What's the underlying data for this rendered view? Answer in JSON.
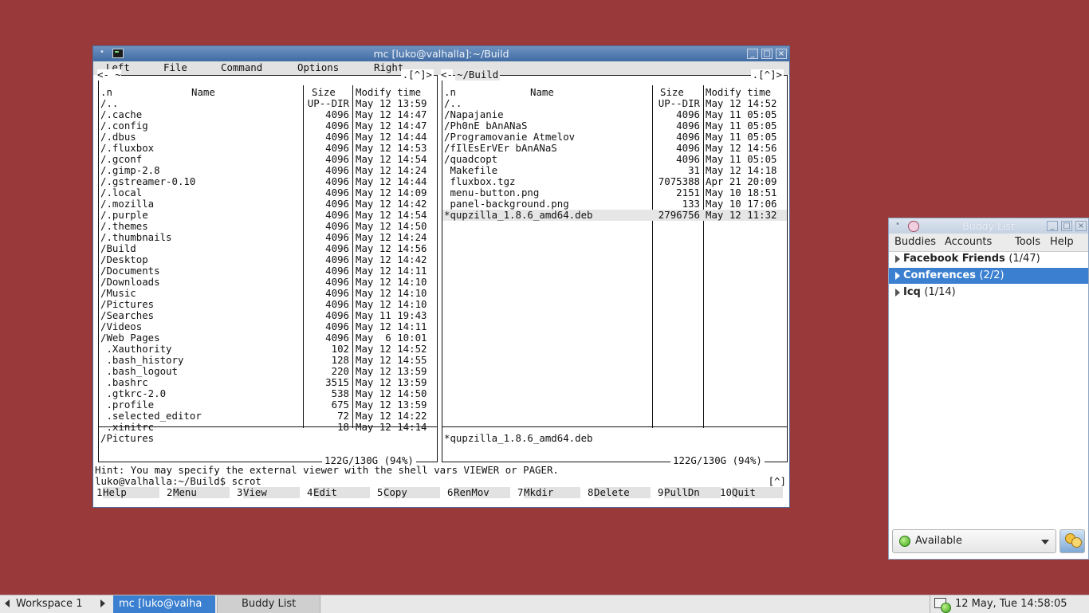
{
  "mc_window": {
    "title": "mc [luko@valhalla]:~/Build",
    "menu": [
      "Left",
      "File",
      "Command",
      "Options",
      "Right"
    ],
    "left_panel": {
      "path": "<- ~",
      "back": "<",
      "controls": ".[^]>",
      "headers": {
        "name_n": ".n",
        "name": "Name",
        "size": "Size",
        "time": "Modify time"
      },
      "rows": [
        {
          "name": "/..",
          "size": "UP--DIR",
          "time": "May 12 13:59"
        },
        {
          "name": "/.cache",
          "size": "4096",
          "time": "May 12 14:47"
        },
        {
          "name": "/.config",
          "size": "4096",
          "time": "May 12 14:47"
        },
        {
          "name": "/.dbus",
          "size": "4096",
          "time": "May 12 14:44"
        },
        {
          "name": "/.fluxbox",
          "size": "4096",
          "time": "May 12 14:53"
        },
        {
          "name": "/.gconf",
          "size": "4096",
          "time": "May 12 14:54"
        },
        {
          "name": "/.gimp-2.8",
          "size": "4096",
          "time": "May 12 14:24"
        },
        {
          "name": "/.gstreamer-0.10",
          "size": "4096",
          "time": "May 12 14:44"
        },
        {
          "name": "/.local",
          "size": "4096",
          "time": "May 12 14:09"
        },
        {
          "name": "/.mozilla",
          "size": "4096",
          "time": "May 12 14:42"
        },
        {
          "name": "/.purple",
          "size": "4096",
          "time": "May 12 14:54"
        },
        {
          "name": "/.themes",
          "size": "4096",
          "time": "May 12 14:50"
        },
        {
          "name": "/.thumbnails",
          "size": "4096",
          "time": "May 12 14:24"
        },
        {
          "name": "/Build",
          "size": "4096",
          "time": "May 12 14:56"
        },
        {
          "name": "/Desktop",
          "size": "4096",
          "time": "May 12 14:42"
        },
        {
          "name": "/Documents",
          "size": "4096",
          "time": "May 12 14:11"
        },
        {
          "name": "/Downloads",
          "size": "4096",
          "time": "May 12 14:10"
        },
        {
          "name": "/Music",
          "size": "4096",
          "time": "May 12 14:10"
        },
        {
          "name": "/Pictures",
          "size": "4096",
          "time": "May 12 14:10"
        },
        {
          "name": "/Searches",
          "size": "4096",
          "time": "May 11 19:43"
        },
        {
          "name": "/Videos",
          "size": "4096",
          "time": "May 12 14:11"
        },
        {
          "name": "/Web Pages",
          "size": "4096",
          "time": "May  6 10:01"
        },
        {
          "name": " .Xauthority",
          "size": "102",
          "time": "May 12 14:52"
        },
        {
          "name": " .bash_history",
          "size": "128",
          "time": "May 12 14:55"
        },
        {
          "name": " .bash_logout",
          "size": "220",
          "time": "May 12 13:59"
        },
        {
          "name": " .bashrc",
          "size": "3515",
          "time": "May 12 13:59"
        },
        {
          "name": " .gtkrc-2.0",
          "size": "538",
          "time": "May 12 14:50"
        },
        {
          "name": " .profile",
          "size": "675",
          "time": "May 12 13:59"
        },
        {
          "name": " .selected_editor",
          "size": "72",
          "time": "May 12 14:22"
        },
        {
          "name": " .xinitrc",
          "size": "18",
          "time": "May 12 14:14"
        }
      ],
      "mini_status": "/Pictures",
      "free_space": "122G/130G (94%)"
    },
    "right_panel": {
      "path": "~/Build",
      "back": "<-",
      "controls": ".[^]>",
      "headers": {
        "name_n": ".n",
        "name": "Name",
        "size": "Size",
        "time": "Modify time"
      },
      "rows": [
        {
          "name": "/..",
          "size": "UP--DIR",
          "time": "May 12 14:52"
        },
        {
          "name": "/Napajanie",
          "size": "4096",
          "time": "May 11 05:05"
        },
        {
          "name": "/Ph0nE bAnANaS",
          "size": "4096",
          "time": "May 11 05:05"
        },
        {
          "name": "/Programovanie Atmelov",
          "size": "4096",
          "time": "May 11 05:05"
        },
        {
          "name": "/fIlEsErVEr bAnANaS",
          "size": "4096",
          "time": "May 12 14:56"
        },
        {
          "name": "/quadcopt",
          "size": "4096",
          "time": "May 11 05:05"
        },
        {
          "name": " Makefile",
          "size": "31",
          "time": "May 12 14:18"
        },
        {
          "name": " fluxbox.tgz",
          "size": "7075388",
          "time": "Apr 21 20:09"
        },
        {
          "name": " menu-button.png",
          "size": "2151",
          "time": "May 10 18:51"
        },
        {
          "name": " panel-background.png",
          "size": "133",
          "time": "May 10 17:06"
        },
        {
          "name": "*qupzilla_1.8.6_amd64.deb",
          "size": "2796756",
          "time": "May 12 11:32"
        }
      ],
      "mini_status": "*qupzilla_1.8.6_amd64.deb",
      "free_space": "122G/130G (94%)"
    },
    "hint": "Hint: You may specify the external viewer with the shell vars VIEWER or PAGER.",
    "command_line": "luko@valhalla:~/Build$ scrot",
    "command_ctrl": "[^]",
    "fkeys": [
      {
        "num": "1",
        "label": "Help"
      },
      {
        "num": "2",
        "label": "Menu"
      },
      {
        "num": "3",
        "label": "View"
      },
      {
        "num": "4",
        "label": "Edit"
      },
      {
        "num": "5",
        "label": "Copy"
      },
      {
        "num": "6",
        "label": "RenMov"
      },
      {
        "num": "7",
        "label": "Mkdir"
      },
      {
        "num": "8",
        "label": "Delete"
      },
      {
        "num": "9",
        "label": "PullDn"
      },
      {
        "num": "10",
        "label": "Quit"
      }
    ]
  },
  "buddy_window": {
    "title": "Buddy List",
    "menu": [
      "Buddies",
      "Accounts",
      "Tools",
      "Help"
    ],
    "groups": [
      {
        "name": "Facebook Friends",
        "count": "(1/47)",
        "selected": false
      },
      {
        "name": "Conferences",
        "count": "(2/2)",
        "selected": true
      },
      {
        "name": "Icq",
        "count": "(1/14)",
        "selected": false
      }
    ],
    "status": "Available"
  },
  "taskbar": {
    "workspace": "Workspace 1",
    "tasks": [
      "mc [luko@valha",
      "Buddy List"
    ],
    "clock": "12 May, Tue 14:58:05"
  },
  "colors": {
    "desktop": "#993939",
    "accent": "#3a7fd0"
  }
}
